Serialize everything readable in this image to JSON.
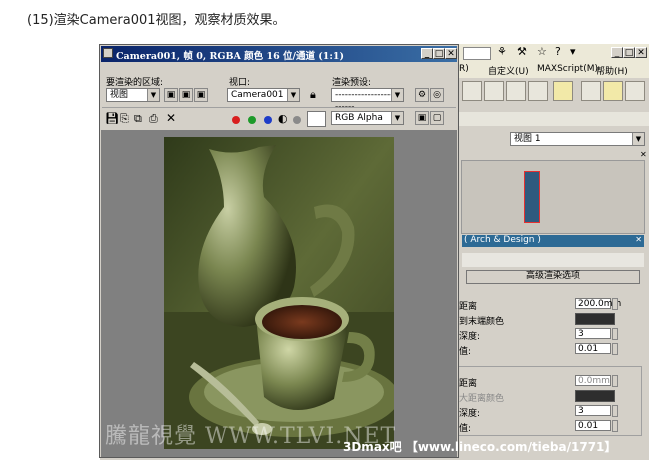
{
  "caption": "(15)渲染Camera001视图，观察材质效果。",
  "render_frame": {
    "title": "Camera001, 帧 0, RGBA 颜色 16 位/通道 (1:1)",
    "area_label": "要渲染的区域:",
    "area_value": "视图",
    "viewport_label": "视口:",
    "viewport_value": "Camera001",
    "preset_label": "渲染预设:",
    "preset_value": "--------------------------",
    "channel_value": "RGB Alpha",
    "colors": {
      "red": "#d81e1e",
      "green": "#1e9a2a",
      "blue": "#1e3cc8"
    }
  },
  "app": {
    "menu": [
      "R)",
      "自定义(U)",
      "MAXScript(M)",
      "帮助(H)"
    ],
    "viewport_dropdown": "视图 1",
    "section_arch": "( Arch & Design )",
    "advanced_button": "高级渲染选项",
    "group1": {
      "rows": [
        {
          "label": "距离",
          "value": "200.0mm"
        },
        {
          "label": "到末端颜色",
          "value": ""
        },
        {
          "label": "深度:",
          "value": "3"
        },
        {
          "label": "值:",
          "value": "0.01"
        }
      ]
    },
    "group2": {
      "rows": [
        {
          "label": "距离",
          "value": "0.0mm"
        },
        {
          "label": "大距离颜色",
          "value": ""
        },
        {
          "label": "深度:",
          "value": "3"
        },
        {
          "label": "值:",
          "value": "0.01"
        }
      ]
    }
  },
  "watermark": {
    "left": "騰龍視覺 WWW.TLVI.NET",
    "right": "3Dmax吧 【www.lineco.com/tieba/1771】"
  }
}
